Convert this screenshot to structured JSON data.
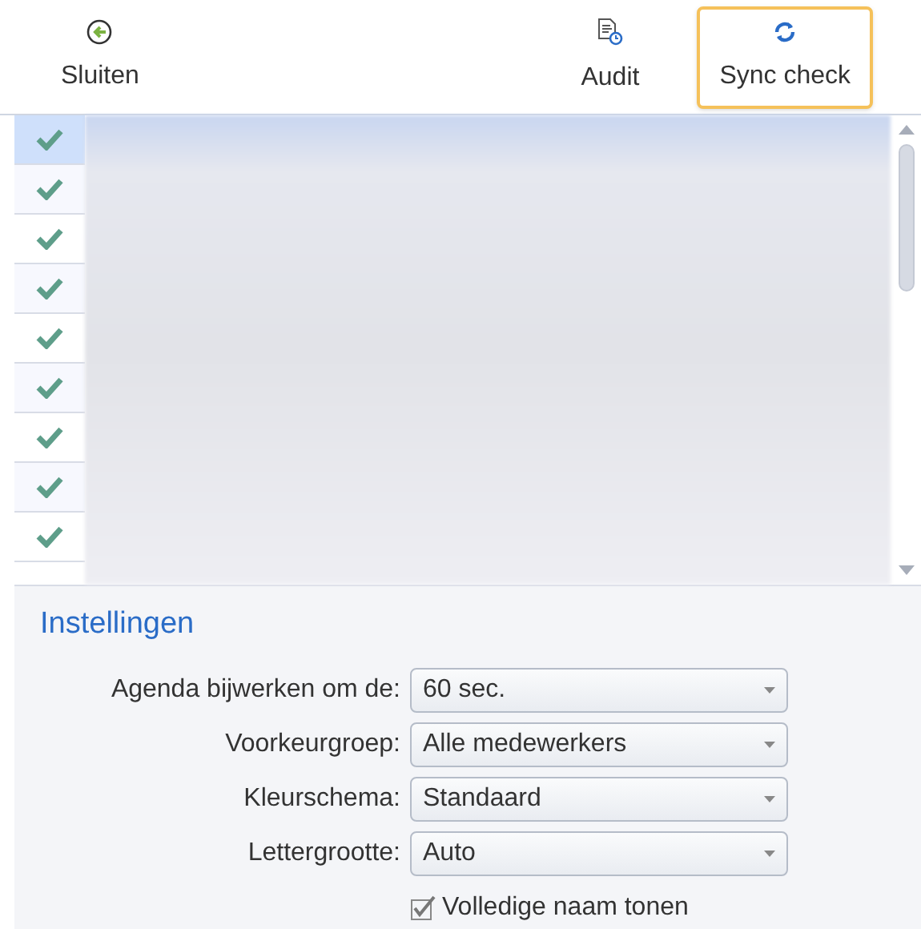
{
  "toolbar": [
    {
      "label": "Sluiten",
      "kind": "close",
      "highlighted": false
    },
    {
      "label": "Audit",
      "kind": "audit",
      "highlighted": false
    },
    {
      "label": "Sync check",
      "kind": "sync",
      "highlighted": true
    }
  ],
  "list": {
    "rows": [
      {
        "checked": true,
        "selected": true
      },
      {
        "checked": true,
        "selected": false
      },
      {
        "checked": true,
        "selected": false
      },
      {
        "checked": true,
        "selected": false
      },
      {
        "checked": true,
        "selected": false
      },
      {
        "checked": true,
        "selected": false
      },
      {
        "checked": true,
        "selected": false
      },
      {
        "checked": true,
        "selected": false
      },
      {
        "checked": true,
        "selected": false
      }
    ]
  },
  "settings": {
    "title": "Instellingen",
    "fields": [
      {
        "label": "Agenda bijwerken om de:",
        "value": "60 sec."
      },
      {
        "label": "Voorkeurgroep:",
        "value": "Alle medewerkers"
      },
      {
        "label": "Kleurschema:",
        "value": "Standaard"
      },
      {
        "label": "Lettergrootte:",
        "value": "Auto"
      }
    ],
    "checkbox": {
      "label": "Volledige naam tonen",
      "checked": true
    }
  }
}
